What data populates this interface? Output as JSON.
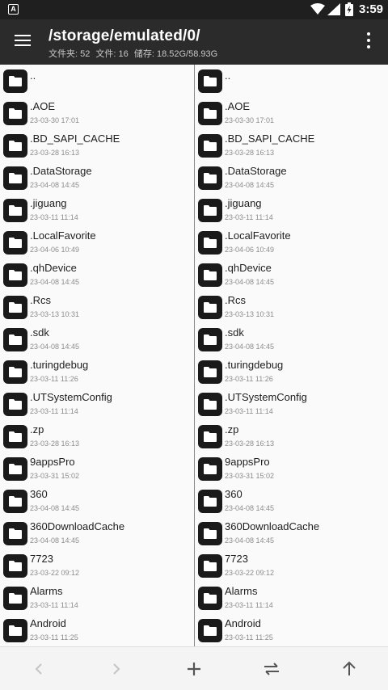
{
  "status_bar": {
    "time": "3:59",
    "app_badge": "A",
    "battery_glyph": "⚡"
  },
  "header": {
    "path": "/storage/emulated/0/",
    "info": {
      "folders": "文件夹: 52",
      "files": "文件: 16",
      "storage": "储存: 18.52G/58.93G"
    }
  },
  "colors": {
    "app_bar": "#2b2b2b",
    "status_bar": "#1f1f1f",
    "folder_icon": "#1a1a1a",
    "disabled_icon": "#c4c4c4",
    "active_icon": "#555555"
  },
  "panes": {
    "left": {
      "parent_label": "..",
      "items": [
        {
          "name": ".AOE",
          "date": "23-03-30 17:01"
        },
        {
          "name": ".BD_SAPI_CACHE",
          "date": "23-03-28 16:13"
        },
        {
          "name": ".DataStorage",
          "date": "23-04-08 14:45"
        },
        {
          "name": ".jiguang",
          "date": "23-03-11 11:14"
        },
        {
          "name": ".LocalFavorite",
          "date": "23-04-06 10:49"
        },
        {
          "name": ".qhDevice",
          "date": "23-04-08 14:45"
        },
        {
          "name": ".Rcs",
          "date": "23-03-13 10:31"
        },
        {
          "name": ".sdk",
          "date": "23-04-08 14:45"
        },
        {
          "name": ".turingdebug",
          "date": "23-03-11 11:26"
        },
        {
          "name": ".UTSystemConfig",
          "date": "23-03-11 11:14"
        },
        {
          "name": ".zp",
          "date": "23-03-28 16:13"
        },
        {
          "name": "9appsPro",
          "date": "23-03-31 15:02"
        },
        {
          "name": "360",
          "date": "23-04-08 14:45"
        },
        {
          "name": "360DownloadCache",
          "date": "23-04-08 14:45"
        },
        {
          "name": "7723",
          "date": "23-03-22 09:12"
        },
        {
          "name": "Alarms",
          "date": "23-03-11 11:14"
        },
        {
          "name": "Android",
          "date": "23-03-11 11:25"
        }
      ]
    },
    "right": {
      "parent_label": "..",
      "items": [
        {
          "name": ".AOE",
          "date": "23-03-30 17:01"
        },
        {
          "name": ".BD_SAPI_CACHE",
          "date": "23-03-28 16:13"
        },
        {
          "name": ".DataStorage",
          "date": "23-04-08 14:45"
        },
        {
          "name": ".jiguang",
          "date": "23-03-11 11:14"
        },
        {
          "name": ".LocalFavorite",
          "date": "23-04-06 10:49"
        },
        {
          "name": ".qhDevice",
          "date": "23-04-08 14:45"
        },
        {
          "name": ".Rcs",
          "date": "23-03-13 10:31"
        },
        {
          "name": ".sdk",
          "date": "23-04-08 14:45"
        },
        {
          "name": ".turingdebug",
          "date": "23-03-11 11:26"
        },
        {
          "name": ".UTSystemConfig",
          "date": "23-03-11 11:14"
        },
        {
          "name": ".zp",
          "date": "23-03-28 16:13"
        },
        {
          "name": "9appsPro",
          "date": "23-03-31 15:02"
        },
        {
          "name": "360",
          "date": "23-04-08 14:45"
        },
        {
          "name": "360DownloadCache",
          "date": "23-04-08 14:45"
        },
        {
          "name": "7723",
          "date": "23-03-22 09:12"
        },
        {
          "name": "Alarms",
          "date": "23-03-11 11:14"
        },
        {
          "name": "Android",
          "date": "23-03-11 11:25"
        }
      ]
    }
  },
  "toolbar": {
    "buttons": [
      {
        "icon": "back-arrow-icon",
        "enabled": false
      },
      {
        "icon": "forward-arrow-icon",
        "enabled": false
      },
      {
        "icon": "plus-icon",
        "enabled": true
      },
      {
        "icon": "swap-panes-icon",
        "enabled": true
      },
      {
        "icon": "up-arrow-icon",
        "enabled": true
      }
    ]
  }
}
